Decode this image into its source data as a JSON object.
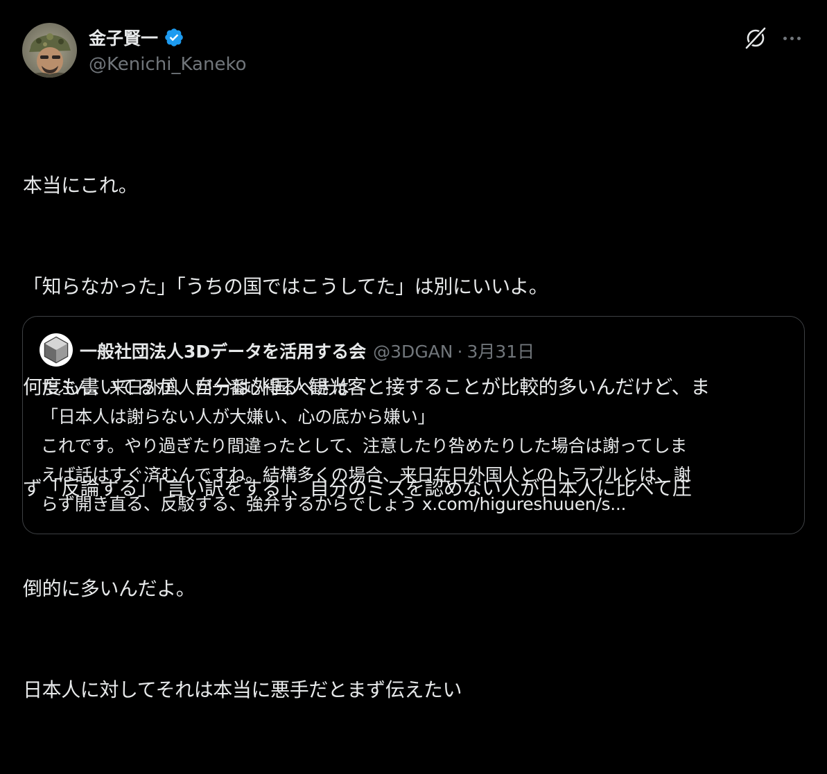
{
  "author": {
    "name": "金子賢一",
    "handle": "@Kenichi_Kaneko",
    "verified": true
  },
  "post": {
    "lines": [
      "本当にこれ。",
      "「知らなかった」「うちの国ではこうしてた」は別にいいよ。",
      "何度も書いてるが、自分は外国人観光客と接することが比較的多いんだけど、ま",
      "ず「反論する」「言い訳をする」、自分のミスを認めない人が日本人に比べて圧",
      "倒的に多いんだよ。",
      "日本人に対してそれは本当に悪手だとまず伝えたい"
    ]
  },
  "quote": {
    "name": "一般社団法人3Dデータを活用する会",
    "handle": "@3DGAN",
    "separator": "·",
    "date": "3月31日",
    "lines": [
      "たぶん、来日外国人が一番心得るべきは",
      "「日本人は謝らない人が大嫌い、心の底から嫌い」",
      "これです。やり過ぎたり間違ったとして、注意したり咎めたりした場合は謝ってしま",
      "えば話はすぐ済むんですね。結構多くの場合、来日在日外国人とのトラブルとは、謝",
      "らず開き直る、反駁する、強弁するからでしょう x.com/higureshuuen/s..."
    ]
  },
  "icons": {
    "verified": "verified-badge-icon",
    "grok": "grok-icon",
    "more": "more-options-icon"
  },
  "colors": {
    "background": "#000000",
    "text": "#e7e9ea",
    "secondary": "#71767b",
    "verified": "#1d9bf0",
    "border": "#3e4144"
  }
}
